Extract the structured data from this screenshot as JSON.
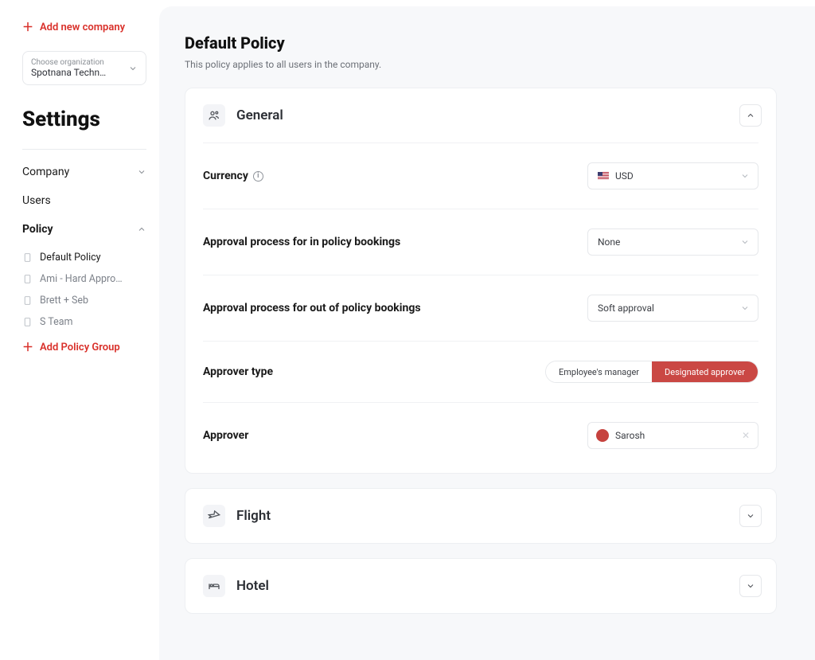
{
  "sidebar": {
    "add_company_label": "Add new company",
    "org_label": "Choose organization",
    "org_value": "Spotnana Techn…",
    "settings_title": "Settings",
    "nav_company": "Company",
    "nav_users": "Users",
    "nav_policy": "Policy",
    "policy_items": [
      {
        "label": "Default Policy"
      },
      {
        "label": "Ami - Hard Appro…"
      },
      {
        "label": "Brett + Seb"
      },
      {
        "label": "S Team"
      }
    ],
    "add_policy_group": "Add Policy Group"
  },
  "page": {
    "title": "Default Policy",
    "subtitle": "This policy applies to all users in the company."
  },
  "general": {
    "section_title": "General",
    "currency_label": "Currency",
    "currency_value": "USD",
    "approval_in_label": "Approval process for in policy bookings",
    "approval_in_value": "None",
    "approval_out_label": "Approval process for out of policy bookings",
    "approval_out_value": "Soft approval",
    "approver_type_label": "Approver type",
    "approver_type_opts": {
      "employees_manager": "Employee's manager",
      "designated_approver": "Designated approver"
    },
    "approver_label": "Approver",
    "approver_value": "Sarosh"
  },
  "sections": {
    "flight": "Flight",
    "hotel": "Hotel"
  }
}
